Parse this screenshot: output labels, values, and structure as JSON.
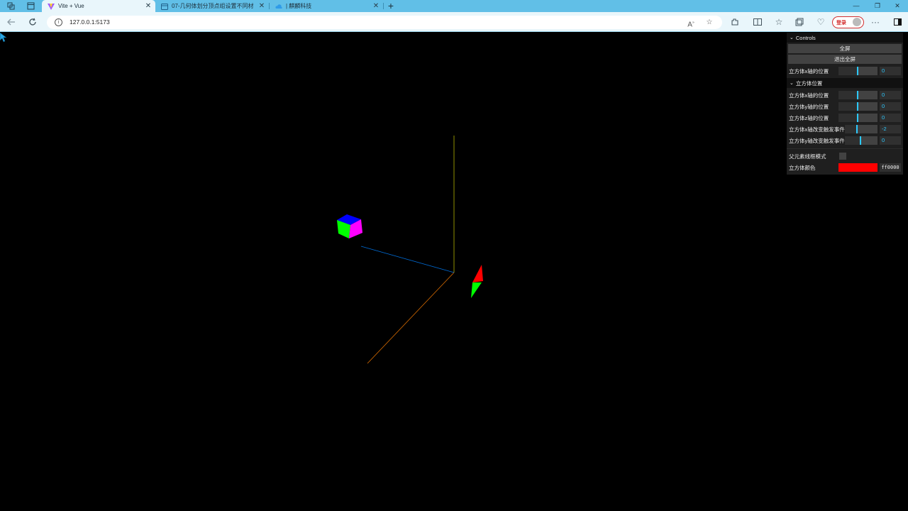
{
  "browser": {
    "tabs": [
      {
        "title": "Vite + Vue",
        "active": true
      },
      {
        "title": "07-几何体划分顶点组设置不同材",
        "active": false
      },
      {
        "title": "| 麒麟科技",
        "active": false
      }
    ],
    "address": "127.0.0.1:5173",
    "profile_badge": "登录",
    "window_controls": [
      "minimize",
      "restore",
      "close"
    ]
  },
  "gui": {
    "title": "Controls",
    "buttons": [
      "全屏",
      "退出全屏"
    ],
    "top_row": {
      "label": "立方体x轴的位置",
      "value": "0"
    },
    "folder": {
      "title": "立方体位置",
      "rows": [
        {
          "label": "立方体x轴的位置",
          "value": "0"
        },
        {
          "label": "立方体y轴的位置",
          "value": "0"
        },
        {
          "label": "立方体z轴的位置",
          "value": "0"
        },
        {
          "label": "立方体x轴改变触发事件",
          "value": "-2"
        },
        {
          "label": "立方体y轴改变触发事件",
          "value": "0"
        }
      ]
    },
    "wireframe_label": "父元素线框模式",
    "color_label": "立方体颜色",
    "color_hex": "ff0000",
    "color_value": "#ff0000"
  },
  "scene": {
    "background": "#000000",
    "axis_colors": {
      "x": "#ff7f00",
      "y": "#d6d600",
      "z": "#0080ff"
    }
  }
}
